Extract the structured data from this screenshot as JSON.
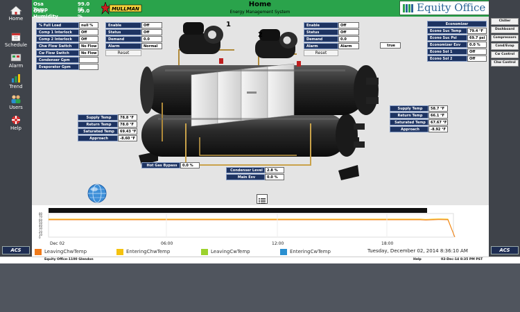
{
  "header": {
    "osa_temp_label": "Osa Temp",
    "osa_temp_value": "99.0 °F",
    "osa_humidity_label": "Osa Humidity",
    "osa_humidity_value": "99.0 %",
    "logo_text": "MULLMAN",
    "title": "Home",
    "subtitle": "Energy Management System",
    "brand": "Equity Office"
  },
  "sidebar": {
    "items": [
      {
        "label": "Home",
        "icon": "home-icon"
      },
      {
        "label": "Schedule",
        "icon": "calendar-icon"
      },
      {
        "label": "Alarm",
        "icon": "alarm-icon"
      },
      {
        "label": "Trend",
        "icon": "trend-icon"
      },
      {
        "label": "Users",
        "icon": "users-icon"
      },
      {
        "label": "Help",
        "icon": "help-icon"
      }
    ],
    "acs_label": "ACS"
  },
  "rightbar": {
    "items": [
      "Chiller",
      "Dashboard",
      "Compressors",
      "Cond/Evap",
      "Cw Control",
      "Chw Control"
    ]
  },
  "status_panel": [
    {
      "label": "% Full Load",
      "value": "null %"
    },
    {
      "label": "Comp 1 Interlock",
      "value": "Off"
    },
    {
      "label": "Comp 2 Interlock",
      "value": "Off"
    },
    {
      "label": "Chw Flow Switch",
      "value": "No Flow"
    },
    {
      "label": "Cw Flow Switch",
      "value": "No Flow"
    },
    {
      "label": "Condenser Gpm",
      "value": ""
    },
    {
      "label": "Evaporator Gpm",
      "value": ""
    }
  ],
  "comp1": {
    "rows": [
      {
        "label": "Enable",
        "value": "Off"
      },
      {
        "label": "Status",
        "value": "Off"
      },
      {
        "label": "Demand",
        "value": "0.0"
      },
      {
        "label": "Alarm",
        "value": "Normal"
      }
    ],
    "reset": "Reset",
    "number": "1"
  },
  "comp2": {
    "rows": [
      {
        "label": "Enable",
        "value": "Off"
      },
      {
        "label": "Status",
        "value": "Off"
      },
      {
        "label": "Demand",
        "value": "0.0"
      },
      {
        "label": "Alarm",
        "value": "Alarm"
      }
    ],
    "reset": "Reset",
    "number": "2"
  },
  "true_badge": "true",
  "economizer": {
    "title": "Economizer",
    "rows": [
      {
        "label": "Econo Suc Temp",
        "value": "79.4 °F"
      },
      {
        "label": "Econo Suc Psi",
        "value": "69.7 psi"
      },
      {
        "label": "Economizer Exv",
        "value": "0.0 %"
      },
      {
        "label": "Econo Sol 1",
        "value": "Off"
      },
      {
        "label": "Econo Sol 2",
        "value": "Off"
      }
    ]
  },
  "condenser_panel": [
    {
      "label": "Supply Temp",
      "value": "78.8 °F"
    },
    {
      "label": "Return Temp",
      "value": "78.0 °F"
    },
    {
      "label": "Saturated Temp",
      "value": "69.43 °F"
    },
    {
      "label": "Approach",
      "value": "-8.60 °F"
    }
  ],
  "evaporator_panel": [
    {
      "label": "Supply Temp",
      "value": "58.7 °F"
    },
    {
      "label": "Return Temp",
      "value": "66.1 °F"
    },
    {
      "label": "Saturated Temp",
      "value": "67.67 °F"
    },
    {
      "label": "Approach",
      "value": "-8.92 °F"
    }
  ],
  "hot_gas": {
    "label": "Hot Gas Bypass",
    "value": "0.0 %"
  },
  "condenser_level": {
    "label": "Condenser Level",
    "value": "2.8 %"
  },
  "main_exv": {
    "label": "Main Exv",
    "value": "0.0 %"
  },
  "trend": {
    "y_ticks": [
      "80",
      "70",
      "60",
      "50",
      "40",
      "30",
      "20",
      "10",
      "0"
    ],
    "x_ticks": [
      "Dec 02",
      "06:00",
      "12:00",
      "18:00"
    ],
    "legend": [
      {
        "name": "LeavingChwTemp",
        "color": "#f07a1a"
      },
      {
        "name": "EnteringChwTemp",
        "color": "#f5c20f"
      },
      {
        "name": "LeavingCwTemp",
        "color": "#9cd22d"
      },
      {
        "name": "EnteringCwTemp",
        "color": "#2a8fd0"
      }
    ],
    "datetime": "Tuesday, December 02, 2014 8:36:10 AM"
  },
  "status_bar": {
    "site": "Equity Office-1100 Glendon",
    "help": "Help",
    "timestamp": "02-Dec-14 8:35 PM PST"
  }
}
